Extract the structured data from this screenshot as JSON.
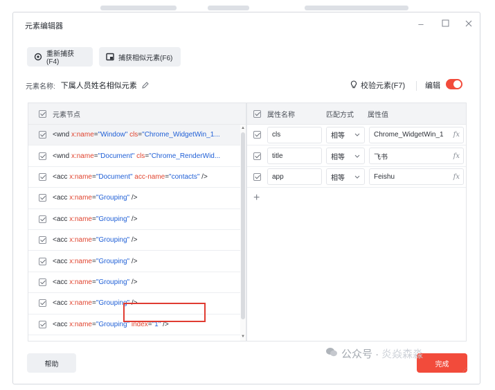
{
  "dialog": {
    "title": "元素编辑器",
    "recapture_label": "重新捕获(F4)",
    "capture_similar_label": "捕获相似元素(F6)",
    "name_label": "元素名称:",
    "name_value": "下属人员姓名相似元素",
    "verify_label": "校验元素(F7)",
    "edit_label": "编辑",
    "edit_enabled": true,
    "help_label": "帮助",
    "done_label": "完成"
  },
  "left_panel": {
    "header": "元素节点",
    "rows": [
      {
        "open": "<wnd",
        "attrs": [
          {
            "name": "x:name",
            "value": "\"Window\""
          },
          {
            "name": "cls",
            "value": "\"Chrome_WidgetWin_1..."
          }
        ],
        "close": ""
      },
      {
        "open": "<wnd",
        "attrs": [
          {
            "name": "x:name",
            "value": "\"Document\""
          },
          {
            "name": "cls",
            "value": "\"Chrome_RenderWid..."
          }
        ],
        "close": ""
      },
      {
        "open": "<acc",
        "attrs": [
          {
            "name": "x:name",
            "value": "\"Document\""
          },
          {
            "name": "acc-name",
            "value": "\"contacts\""
          }
        ],
        "close": "/>"
      },
      {
        "open": "<acc",
        "attrs": [
          {
            "name": "x:name",
            "value": "\"Grouping\""
          }
        ],
        "close": "/>"
      },
      {
        "open": "<acc",
        "attrs": [
          {
            "name": "x:name",
            "value": "\"Grouping\""
          }
        ],
        "close": "/>"
      },
      {
        "open": "<acc",
        "attrs": [
          {
            "name": "x:name",
            "value": "\"Grouping\""
          }
        ],
        "close": "/>"
      },
      {
        "open": "<acc",
        "attrs": [
          {
            "name": "x:name",
            "value": "\"Grouping\""
          }
        ],
        "close": "/>"
      },
      {
        "open": "<acc",
        "attrs": [
          {
            "name": "x:name",
            "value": "\"Grouping\""
          }
        ],
        "close": "/>"
      },
      {
        "open": "<acc",
        "attrs": [
          {
            "name": "x:name",
            "value": "\"Grouping\""
          }
        ],
        "close": "/>"
      },
      {
        "open": "<acc",
        "attrs": [
          {
            "name": "x:name",
            "value": "\"Grouping\""
          },
          {
            "name": "index",
            "value": "\"1\""
          }
        ],
        "close": "/>"
      }
    ]
  },
  "right_panel": {
    "headers": [
      "属性名称",
      "匹配方式",
      "属性值"
    ],
    "rows": [
      {
        "name": "cls",
        "match": "相等",
        "value": "Chrome_WidgetWin_1"
      },
      {
        "name": "title",
        "match": "相等",
        "value": "飞书"
      },
      {
        "name": "app",
        "match": "相等",
        "value": "Feishu"
      }
    ],
    "add_symbol": "+",
    "fx_symbol": "fx"
  },
  "watermark": {
    "text": "公众号 ·",
    "name": "炎焱森淼"
  },
  "colors": {
    "accent": "#f24b3b",
    "attr_name": "#e0442f",
    "attr_value": "#1f5fd6"
  }
}
